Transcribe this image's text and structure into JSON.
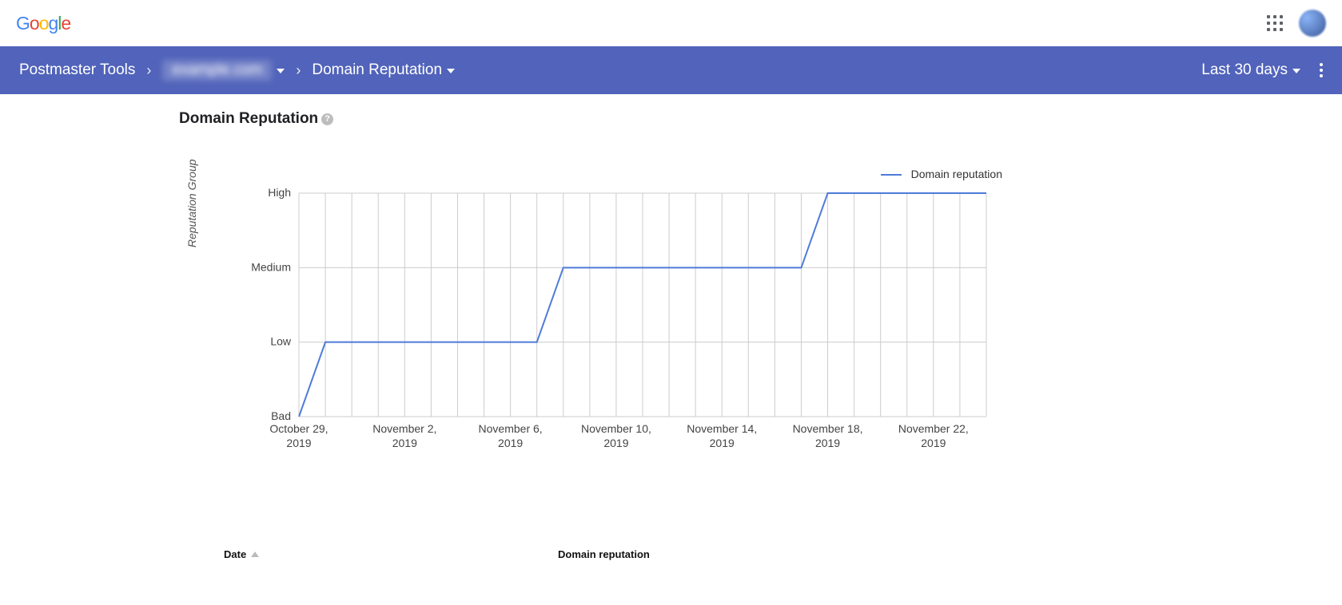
{
  "header": {
    "logo_text": "Google"
  },
  "breadcrumb": {
    "root": "Postmaster Tools",
    "domain_hidden": "example.com",
    "page": "Domain Reputation",
    "range": "Last 30 days"
  },
  "page": {
    "title": "Domain Reputation",
    "y_axis_title": "Reputation Group"
  },
  "legend": {
    "series": "Domain reputation"
  },
  "table": {
    "col_date": "Date",
    "col_rep": "Domain reputation"
  },
  "chart_data": {
    "type": "line",
    "title": "Domain Reputation",
    "xlabel": "",
    "ylabel": "Reputation Group",
    "y_categories": [
      "Bad",
      "Low",
      "Medium",
      "High"
    ],
    "x_tick_labels": [
      "October 29, 2019",
      "November 2, 2019",
      "November 6, 2019",
      "November 10, 2019",
      "November 14, 2019",
      "November 18, 2019",
      "November 22, 2019"
    ],
    "series": [
      {
        "name": "Domain reputation",
        "color": "#4e7bd9",
        "x": [
          "Oct 29",
          "Oct 30",
          "Oct 31",
          "Nov 1",
          "Nov 2",
          "Nov 3",
          "Nov 4",
          "Nov 5",
          "Nov 6",
          "Nov 7",
          "Nov 8",
          "Nov 9",
          "Nov 10",
          "Nov 11",
          "Nov 12",
          "Nov 13",
          "Nov 14",
          "Nov 15",
          "Nov 16",
          "Nov 17",
          "Nov 18",
          "Nov 19",
          "Nov 20",
          "Nov 21",
          "Nov 22",
          "Nov 23",
          "Nov 24"
        ],
        "values": [
          "Bad",
          "Low",
          "Low",
          "Low",
          "Low",
          "Low",
          "Low",
          "Low",
          "Low",
          "Low",
          "Medium",
          "Medium",
          "Medium",
          "Medium",
          "Medium",
          "Medium",
          "Medium",
          "Medium",
          "Medium",
          "Medium",
          "High",
          "High",
          "High",
          "High",
          "High",
          "High",
          "High"
        ]
      }
    ]
  }
}
